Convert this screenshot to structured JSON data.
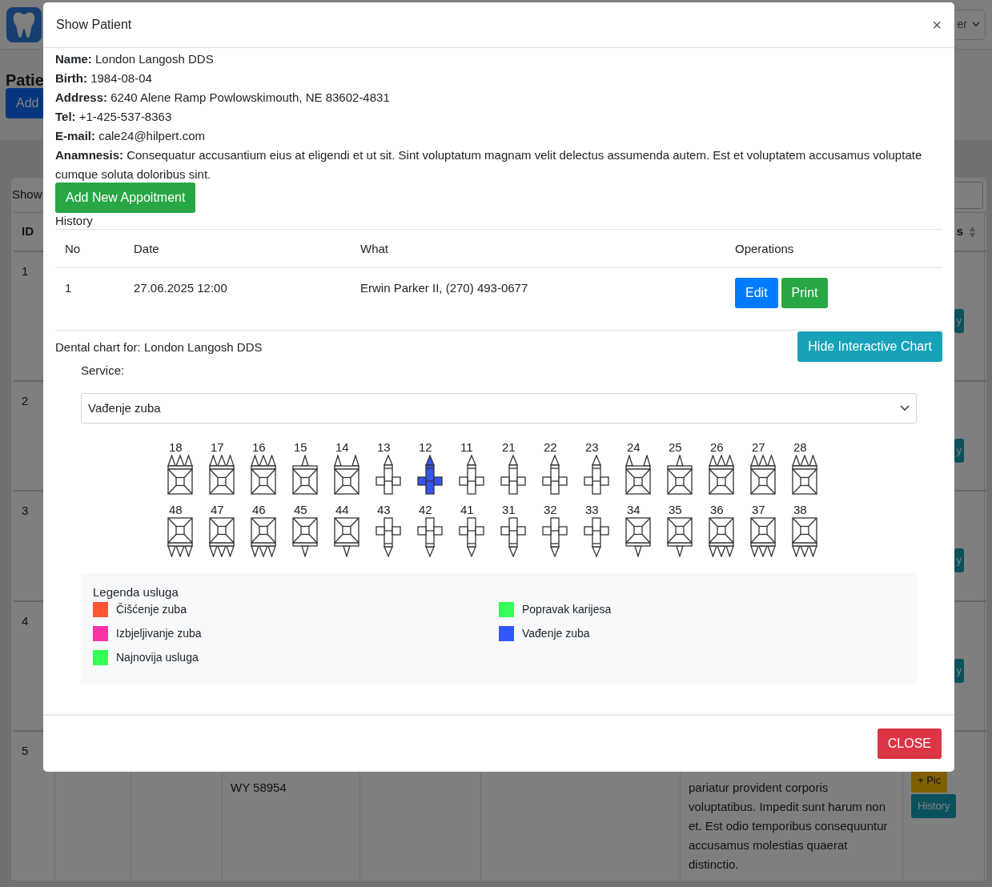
{
  "background": {
    "user_menu": "er",
    "heading": "Patie",
    "add_button": "Add",
    "show_label": "Show",
    "id_header": "ID",
    "column_8_header": "s",
    "rows": [
      {
        "id": "1",
        "actions": [
          "y"
        ]
      },
      {
        "id": "2",
        "actions": [
          "y"
        ]
      },
      {
        "id": "3",
        "actions": [
          "y"
        ]
      },
      {
        "id": "4",
        "actions": [
          "y"
        ]
      },
      {
        "id": "5",
        "address": "WY 58954",
        "notes": "pariatur provident corporis voluptatibus. Impedit sunt harum non et. Est odio temporibus consequuntur accusamus molestias quaerat distinctio.",
        "actions": [
          "+ Pic",
          "History"
        ]
      }
    ]
  },
  "modal": {
    "title": "Show Patient",
    "close": "×",
    "fields": [
      "**Name:** London Langosh DDS",
      "**Birth:** 1984-08-04",
      "**Address:** 6240 Alene Ramp Powlowskimouth, NE 83602-4831",
      "**Tel:** +1-425-537-8363",
      "**E-mail:** cale24@hilpert.com",
      "**Anamnesis:** Consequatur accusantium eius at eligendi et ut sit. Sint voluptatum magnam velit delectus assumenda autem. Est et voluptatem accusamus voluptate cumque soluta doloribus sint."
    ],
    "add_button": "Add New Appoitment",
    "history_label": "History",
    "history": {
      "columns": [
        "No",
        "Date",
        "What",
        "Operations"
      ],
      "rows": [
        {
          "no": "1",
          "date": "27.06.2025 12:00",
          "what": "Erwin Parker II, (270) 493-0677",
          "buttons": [
            "Edit",
            "Print"
          ]
        }
      ]
    },
    "chart_title": "Dental chart for: London Langosh DDS",
    "toggle_button": "Hide Interactive Chart",
    "service_label": "Service:",
    "service_value": "Vađenje zuba",
    "upper_teeth": [
      {
        "number": "18",
        "kind": "molar",
        "selected": false
      },
      {
        "number": "17",
        "kind": "molar",
        "selected": false
      },
      {
        "number": "16",
        "kind": "molar",
        "selected": false
      },
      {
        "number": "15",
        "kind": "premolar1",
        "selected": false
      },
      {
        "number": "14",
        "kind": "premolar2",
        "selected": false
      },
      {
        "number": "13",
        "kind": "anterior",
        "selected": false
      },
      {
        "number": "12",
        "kind": "anterior",
        "selected": true
      },
      {
        "number": "11",
        "kind": "anterior",
        "selected": false
      },
      {
        "number": "21",
        "kind": "anterior",
        "selected": false
      },
      {
        "number": "22",
        "kind": "anterior",
        "selected": false
      },
      {
        "number": "23",
        "kind": "anterior",
        "selected": false
      },
      {
        "number": "24",
        "kind": "premolar2",
        "selected": false
      },
      {
        "number": "25",
        "kind": "premolar1",
        "selected": false
      },
      {
        "number": "26",
        "kind": "molar",
        "selected": false
      },
      {
        "number": "27",
        "kind": "molar",
        "selected": false
      },
      {
        "number": "28",
        "kind": "molar",
        "selected": false
      }
    ],
    "lower_teeth": [
      {
        "number": "48",
        "kind": "molar",
        "selected": false
      },
      {
        "number": "47",
        "kind": "molar",
        "selected": false
      },
      {
        "number": "46",
        "kind": "molar",
        "selected": false
      },
      {
        "number": "45",
        "kind": "premolar1",
        "selected": false
      },
      {
        "number": "44",
        "kind": "premolar1",
        "selected": false
      },
      {
        "number": "43",
        "kind": "anterior",
        "selected": false
      },
      {
        "number": "42",
        "kind": "anterior",
        "selected": false
      },
      {
        "number": "41",
        "kind": "anterior",
        "selected": false
      },
      {
        "number": "31",
        "kind": "anterior",
        "selected": false
      },
      {
        "number": "32",
        "kind": "anterior",
        "selected": false
      },
      {
        "number": "33",
        "kind": "anterior",
        "selected": false
      },
      {
        "number": "34",
        "kind": "premolar1",
        "selected": false
      },
      {
        "number": "35",
        "kind": "premolar1",
        "selected": false
      },
      {
        "number": "36",
        "kind": "molar",
        "selected": false
      },
      {
        "number": "37",
        "kind": "molar",
        "selected": false
      },
      {
        "number": "38",
        "kind": "molar",
        "selected": false
      }
    ],
    "legend_title": "Legenda usluga",
    "legend": [
      {
        "label": "Čišćenje zuba",
        "color": "#ff5733"
      },
      {
        "label": "Popravak karijesa",
        "color": "#33ff57"
      },
      {
        "label": "Izbjeljivanje zuba",
        "color": "#ff33a8"
      },
      {
        "label": "Vađenje zuba",
        "color": "#3357ff"
      },
      {
        "label": "Najnovija usluga",
        "color": "#33ff57"
      }
    ],
    "close_button": "CLOSE"
  }
}
